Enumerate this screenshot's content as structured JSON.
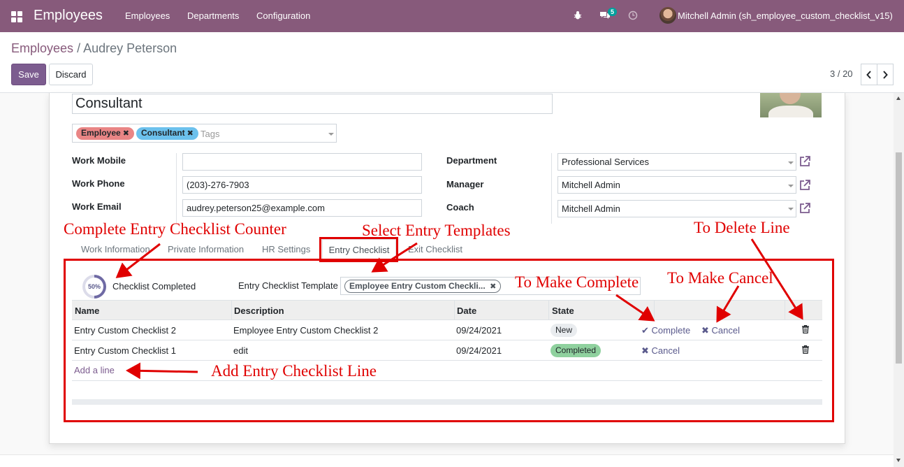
{
  "navbar": {
    "app_title": "Employees",
    "menu": [
      "Employees",
      "Departments",
      "Configuration"
    ],
    "message_count": "5",
    "user": "Mitchell Admin (sh_employee_custom_checklist_v15)"
  },
  "breadcrumb": {
    "parent": "Employees",
    "separator": "/",
    "current": "Audrey Peterson"
  },
  "actions": {
    "save": "Save",
    "discard": "Discard"
  },
  "pager": {
    "text": "3 / 20"
  },
  "employee": {
    "job_title": "Consultant",
    "tags": [
      {
        "label": "Employee",
        "color": "#e98585"
      },
      {
        "label": "Consultant",
        "color": "#6cc1ed"
      }
    ],
    "tags_placeholder": "Tags",
    "fields_left": [
      {
        "label": "Work Mobile",
        "value": ""
      },
      {
        "label": "Work Phone",
        "value": "(203)-276-7903"
      },
      {
        "label": "Work Email",
        "value": "audrey.peterson25@example.com"
      }
    ],
    "fields_right": [
      {
        "label": "Department",
        "value": "Professional Services"
      },
      {
        "label": "Manager",
        "value": "Mitchell Admin"
      },
      {
        "label": "Coach",
        "value": "Mitchell Admin"
      }
    ]
  },
  "tabs": [
    "Work Information",
    "Private Information",
    "HR Settings",
    "Entry Checklist",
    "Exit Checklist"
  ],
  "active_tab": "Entry Checklist",
  "checklist": {
    "progress_percent": 50,
    "progress_label": "50%",
    "completed_label": "Checklist Completed",
    "template_label": "Entry Checklist Template",
    "template_value": "Employee Entry Custom Checkli...",
    "columns": [
      "Name",
      "Description",
      "Date",
      "State"
    ],
    "rows": [
      {
        "name": "Entry Custom Checklist 2",
        "description": "Employee Entry Custom Checklist 2",
        "date": "09/24/2021",
        "state": "New",
        "complete_action": "Complete",
        "cancel_action": "Cancel"
      },
      {
        "name": "Entry Custom Checklist 1",
        "description": "edit",
        "date": "09/24/2021",
        "state": "Completed",
        "complete_action": "",
        "cancel_action": "Cancel"
      }
    ],
    "add_line": "Add a line"
  },
  "annotations": {
    "counter": "Complete Entry Checklist Counter",
    "templates": "Select Entry Templates",
    "delete": "To Delete Line",
    "complete": "To Make Complete",
    "cancel": "To Make Cancel",
    "add": "Add Entry Checklist Line",
    "color": "#e00000"
  },
  "colors": {
    "brand": "#875a7b",
    "primary_button": "#7c5c8f",
    "badge_new": "#e9ecef",
    "badge_completed": "#8fd19e"
  }
}
